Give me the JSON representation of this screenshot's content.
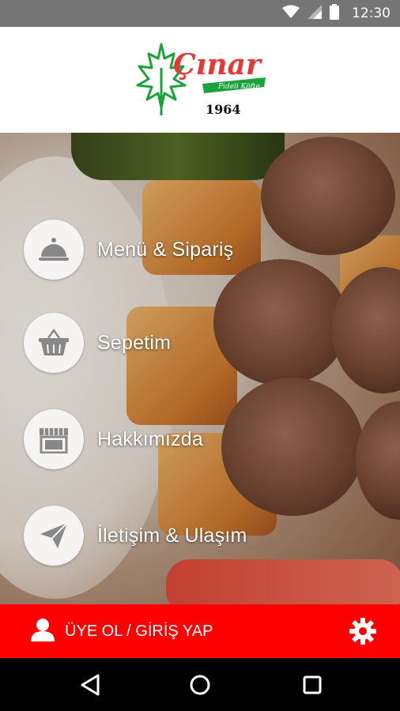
{
  "status_bar": {
    "time": "12:30",
    "icons": [
      "wifi-icon",
      "cellular-signal-icon",
      "battery-icon"
    ]
  },
  "header": {
    "logo_name": "Çınar",
    "logo_tagline": "Pideli Köfte",
    "logo_year": "1964",
    "brand_colors": {
      "red": "#e53935",
      "green": "#1aa33a"
    }
  },
  "menu": [
    {
      "label": "Menü & Sipariş",
      "icon": "cloche-icon"
    },
    {
      "label": "Sepetim",
      "icon": "basket-icon"
    },
    {
      "label": "Hakkımızda",
      "icon": "storefront-icon"
    },
    {
      "label": "İletişim & Ulaşım",
      "icon": "paper-plane-icon"
    }
  ],
  "bottom_bar": {
    "login_label": "ÜYE OL / GİRİŞ YAP",
    "login_icon": "user-icon",
    "settings_icon": "gear-icon",
    "background": "#ff0000"
  },
  "nav_bar": {
    "buttons": [
      "back-icon",
      "home-icon",
      "recents-icon"
    ]
  }
}
